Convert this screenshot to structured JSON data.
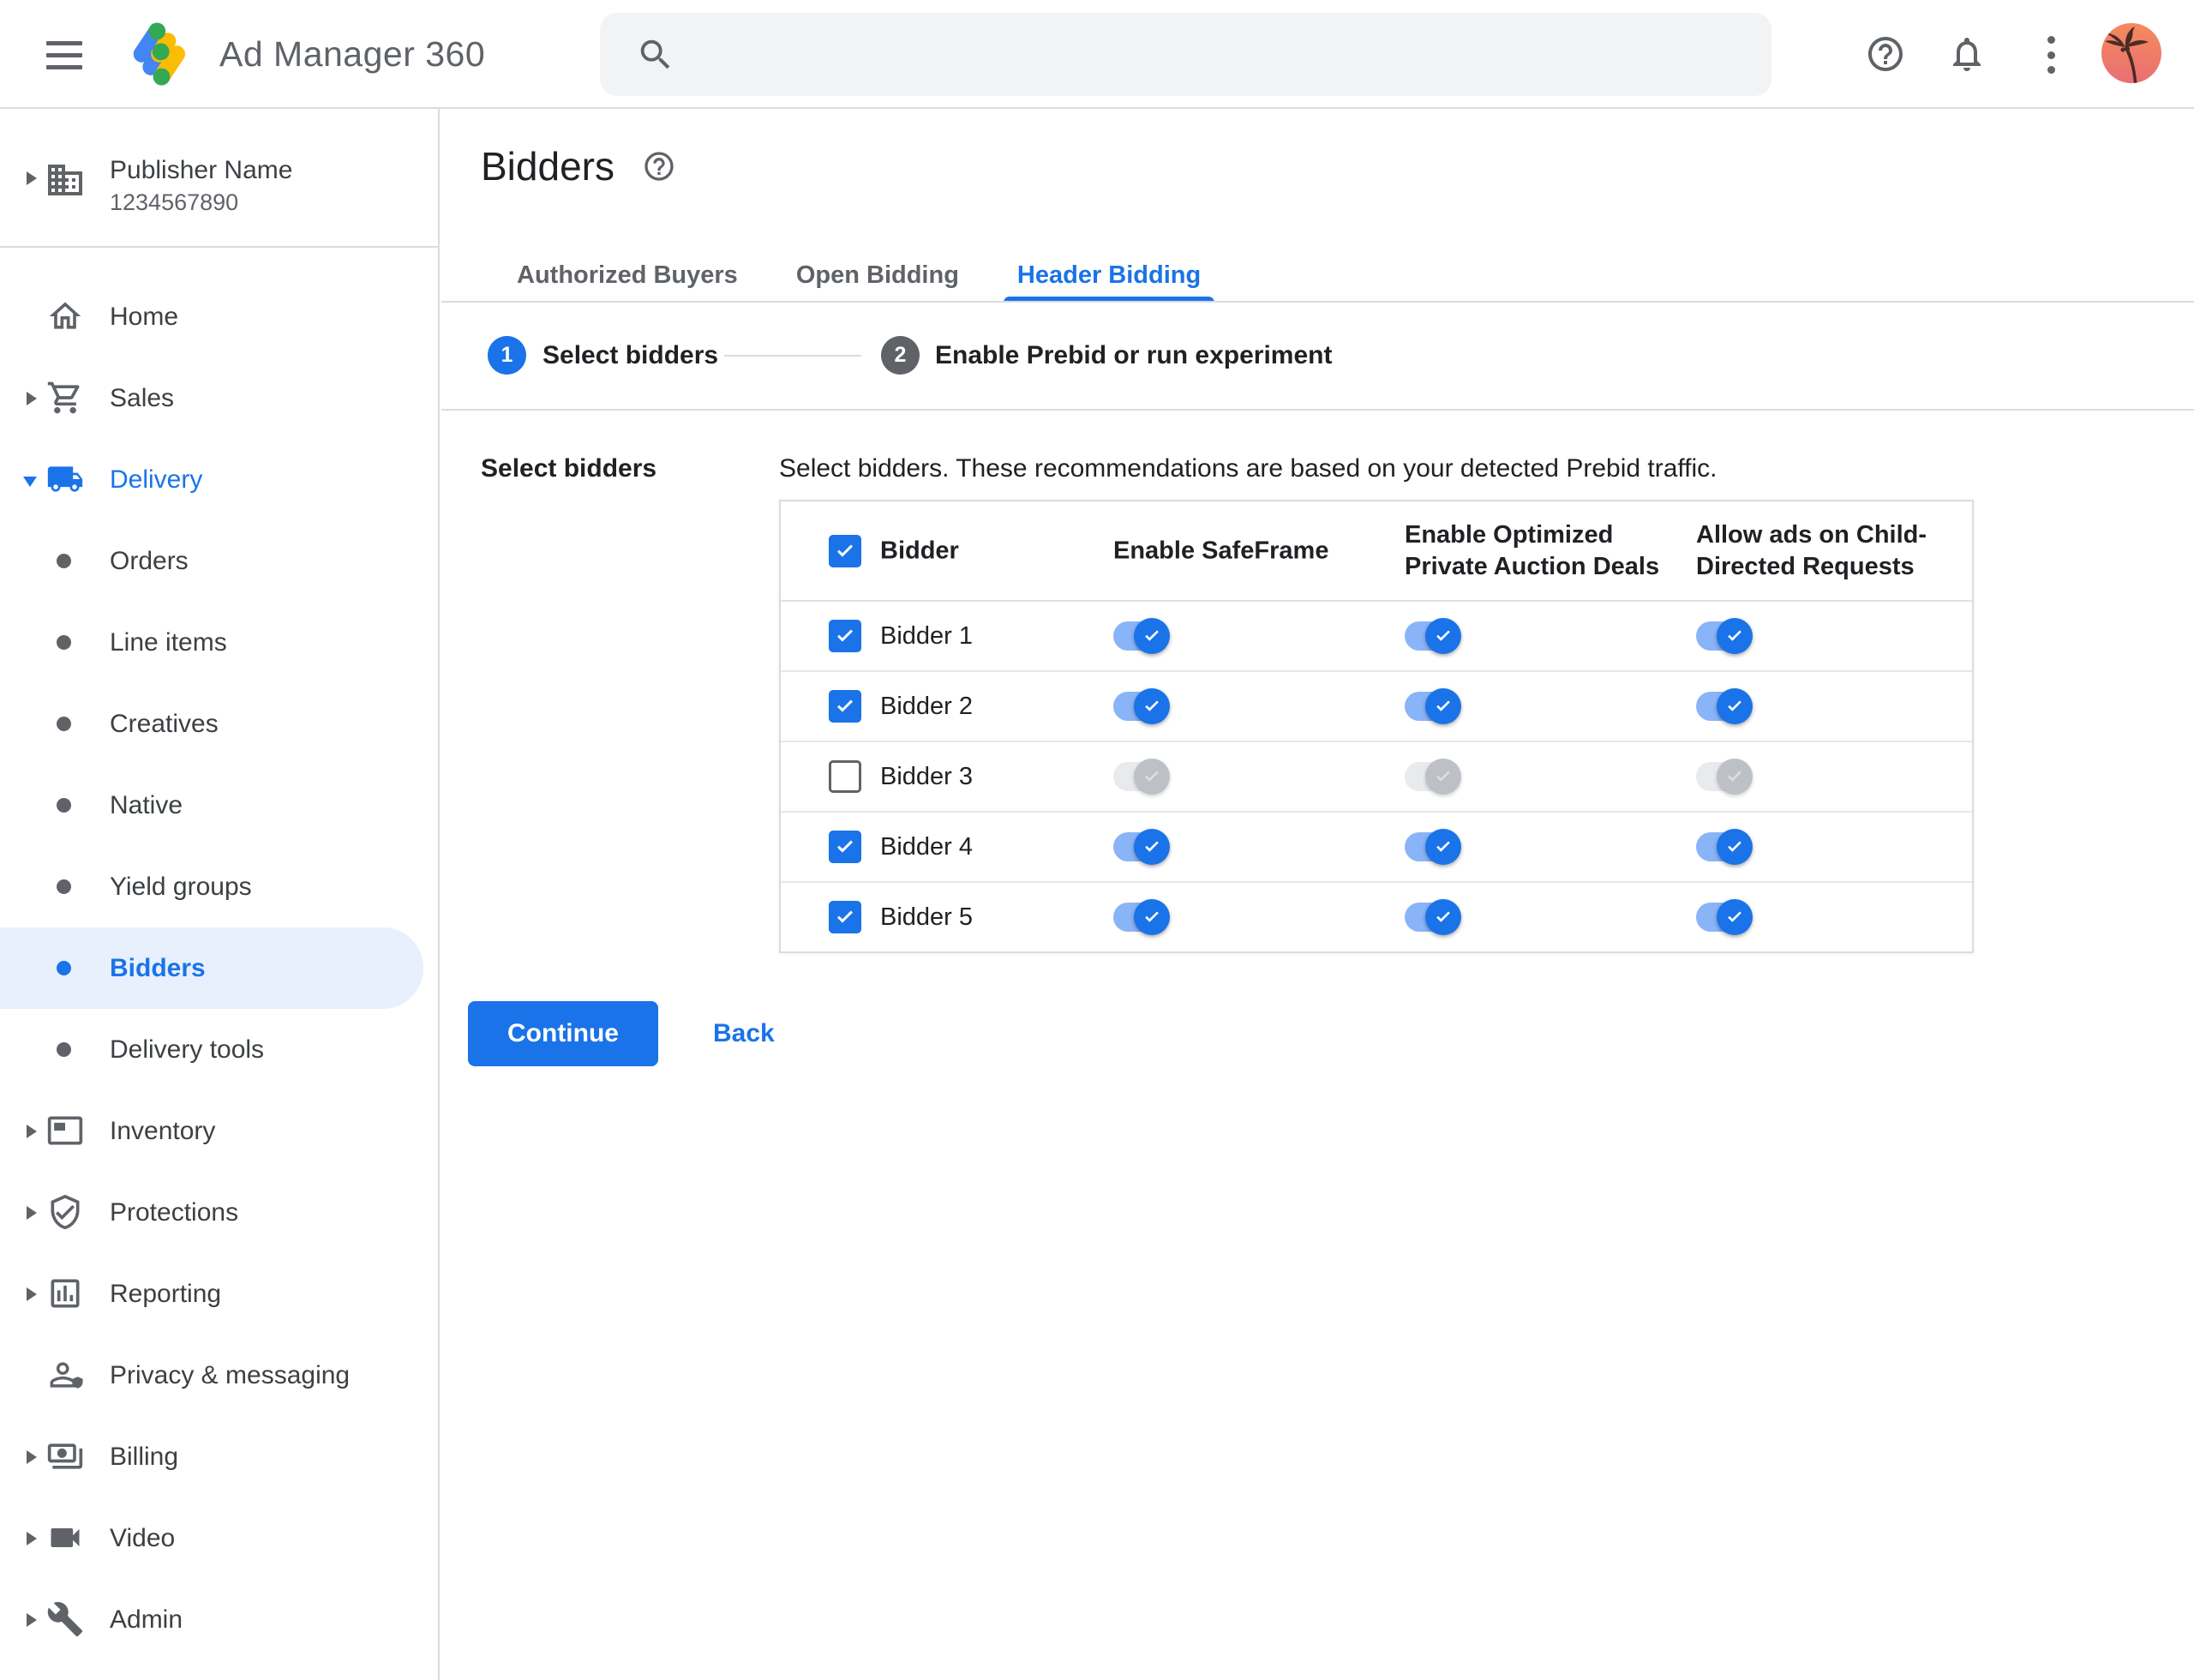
{
  "topbar": {
    "app_name": "Ad Manager 360",
    "search": {
      "value": "",
      "icon": "search-icon"
    },
    "icons": [
      "menu-icon",
      "help-icon",
      "notifications-icon",
      "more-vert-icon",
      "account-avatar"
    ]
  },
  "sidebar": {
    "publisher": {
      "name": "Publisher Name",
      "id": "1234567890",
      "icon": "building-icon"
    },
    "items": [
      {
        "label": "Home",
        "icon": "home-icon",
        "level": "top",
        "arrow": "none"
      },
      {
        "label": "Sales",
        "icon": "cart-icon",
        "level": "top",
        "arrow": "right"
      },
      {
        "label": "Delivery",
        "icon": "truck-icon",
        "level": "top",
        "arrow": "down",
        "active": true
      },
      {
        "label": "Orders",
        "icon": "bullet",
        "level": "sub"
      },
      {
        "label": "Line items",
        "icon": "bullet",
        "level": "sub"
      },
      {
        "label": "Creatives",
        "icon": "bullet",
        "level": "sub"
      },
      {
        "label": "Native",
        "icon": "bullet",
        "level": "sub"
      },
      {
        "label": "Yield groups",
        "icon": "bullet",
        "level": "sub"
      },
      {
        "label": "Bidders",
        "icon": "bullet",
        "level": "sub",
        "selected": true
      },
      {
        "label": "Delivery tools",
        "icon": "bullet",
        "level": "sub"
      },
      {
        "label": "Inventory",
        "icon": "inventory-icon",
        "level": "top",
        "arrow": "right"
      },
      {
        "label": "Protections",
        "icon": "shield-check-icon",
        "level": "top",
        "arrow": "right"
      },
      {
        "label": "Reporting",
        "icon": "bar-chart-icon",
        "level": "top",
        "arrow": "right"
      },
      {
        "label": "Privacy & messaging",
        "icon": "person-badge-icon",
        "level": "top",
        "arrow": "none"
      },
      {
        "label": "Billing",
        "icon": "payments-icon",
        "level": "top",
        "arrow": "right"
      },
      {
        "label": "Video",
        "icon": "videocam-icon",
        "level": "top",
        "arrow": "right"
      },
      {
        "label": "Admin",
        "icon": "wrench-icon",
        "level": "top",
        "arrow": "right"
      }
    ]
  },
  "page": {
    "title": "Bidders",
    "title_help_icon": "help-circle-icon",
    "tabs": [
      {
        "label": "Authorized Buyers",
        "active": false
      },
      {
        "label": "Open Bidding",
        "active": false
      },
      {
        "label": "Header Bidding",
        "active": true
      }
    ],
    "steps": [
      {
        "number": "1",
        "label": "Select bidders",
        "active": true
      },
      {
        "number": "2",
        "label": "Enable Prebid or run experiment",
        "active": false
      }
    ],
    "section_label": "Select bidders",
    "description": "Select bidders. These recommendations are based on your detected Prebid traffic.",
    "table": {
      "select_all_checked": true,
      "columns": [
        "Bidder",
        "Enable SafeFrame",
        "Enable Optimized Private Auction Deals",
        "Allow ads on Child-Directed Requests"
      ],
      "rows": [
        {
          "label": "Bidder 1",
          "checked": true,
          "safeframe": true,
          "optimized": true,
          "child_directed": true
        },
        {
          "label": "Bidder 2",
          "checked": true,
          "safeframe": true,
          "optimized": true,
          "child_directed": true
        },
        {
          "label": "Bidder 3",
          "checked": false,
          "safeframe": false,
          "optimized": false,
          "child_directed": false
        },
        {
          "label": "Bidder 4",
          "checked": true,
          "safeframe": true,
          "optimized": true,
          "child_directed": true
        },
        {
          "label": "Bidder 5",
          "checked": true,
          "safeframe": true,
          "optimized": true,
          "child_directed": true
        }
      ]
    },
    "actions": {
      "continue_label": "Continue",
      "back_label": "Back"
    }
  },
  "colors": {
    "accent": "#1a73e8",
    "toggle_track_on": "#8ab4f8",
    "toggle_disabled_thumb": "#bdc1c6",
    "selected_pill": "#e8f0fe",
    "border": "#dadce0",
    "text_primary": "#202124",
    "text_secondary": "#5f6368",
    "search_bg": "#f1f3f4",
    "logo_blue": "#4285f4",
    "logo_yellow": "#fbbc04",
    "logo_green": "#34a853"
  }
}
